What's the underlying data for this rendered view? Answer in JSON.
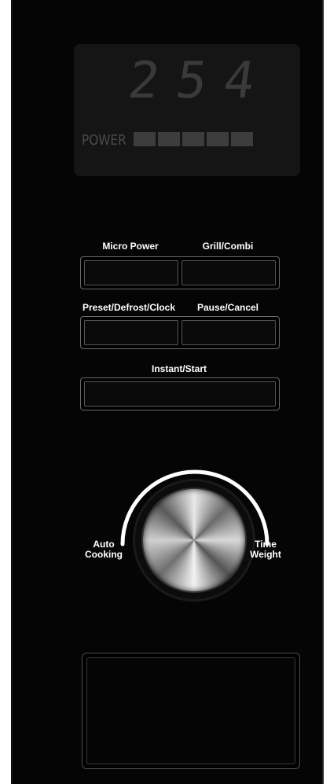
{
  "display": {
    "digits": "254",
    "power_label": "POWER",
    "power_level_segments": 5
  },
  "buttons": {
    "micro_power": "Micro Power",
    "grill_combi": "Grill/Combi",
    "preset_defrost_clock": "Preset/Defrost/Clock",
    "pause_cancel": "Pause/Cancel",
    "instant_start": "Instant/Start"
  },
  "dial": {
    "left_label_line1": "Auto",
    "left_label_line2": "Cooking",
    "right_label_line1": "Time",
    "right_label_line2": "Weight"
  },
  "colors": {
    "panel": "#050505",
    "display_bg": "#151515",
    "segment": "#3d3d3d",
    "label": "#ffffff"
  }
}
